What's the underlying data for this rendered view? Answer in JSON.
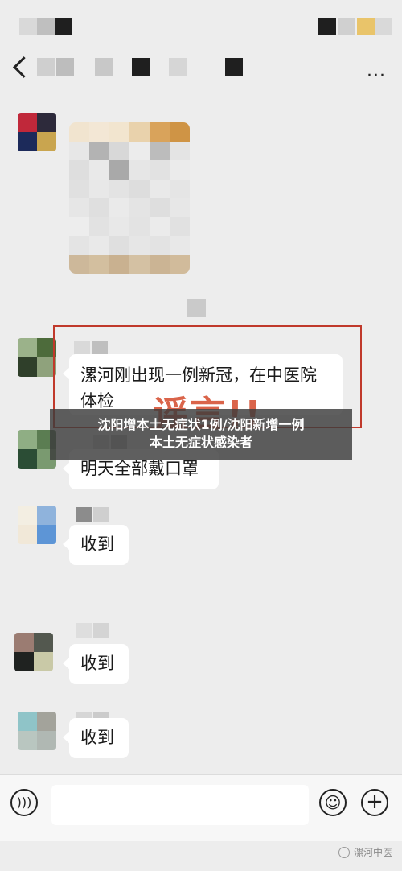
{
  "messages": [
    {
      "text": "漯河刚出现一例新冠，在中医院体检"
    },
    {
      "text": "明天全部戴口罩"
    },
    {
      "text": "收到"
    },
    {
      "text": "收到"
    },
    {
      "text": "收到"
    }
  ],
  "stamp": "谣言!!",
  "overlay": {
    "line1": "沈阳增本土无症状1例/沈阳新增一例",
    "line2": "本土无症状感染者"
  },
  "watermark": "漯河中医",
  "icons": {
    "voice": "voice-icon",
    "emoji": "emoji-icon",
    "plus": "plus-icon",
    "more": "more-icon",
    "back": "back-icon"
  },
  "colors": {
    "background": "#ededed",
    "bubble": "#ffffff",
    "rumor_frame": "#c0392b",
    "stamp": "#d44a2b"
  }
}
